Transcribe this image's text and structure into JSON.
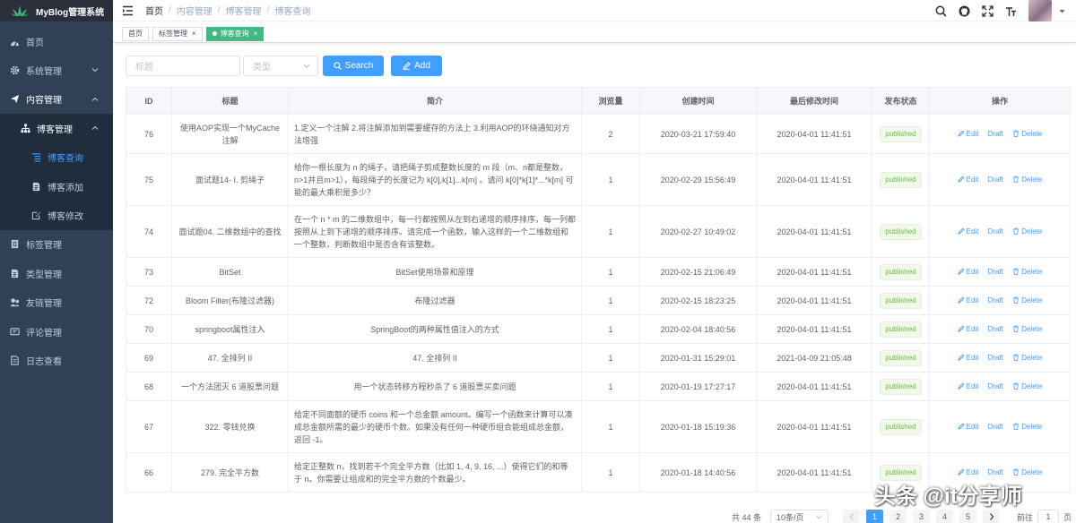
{
  "app": {
    "title": "MyBlog管理系统"
  },
  "sidebar": {
    "items": [
      {
        "label": "首页",
        "icon": "dashboard-icon"
      },
      {
        "label": "系统管理",
        "icon": "gear-icon"
      },
      {
        "label": "内容管理",
        "icon": "send-icon"
      },
      {
        "label": "博客管理",
        "icon": "tree-icon"
      },
      {
        "label": "博客查询",
        "icon": "list-icon"
      },
      {
        "label": "博客添加",
        "icon": "doc-icon"
      },
      {
        "label": "博客修改",
        "icon": "edit-icon"
      },
      {
        "label": "标签管理",
        "icon": "tag-icon"
      },
      {
        "label": "类型管理",
        "icon": "doc-icon"
      },
      {
        "label": "友链管理",
        "icon": "link-icon"
      },
      {
        "label": "评论管理",
        "icon": "chat-icon"
      },
      {
        "label": "日志查看",
        "icon": "log-icon"
      }
    ]
  },
  "breadcrumb": [
    "首页",
    "内容管理",
    "博客管理",
    "博客查询"
  ],
  "tags": [
    {
      "label": "首页"
    },
    {
      "label": "标签管理",
      "close": "×"
    },
    {
      "label": "博客查询",
      "close": "×"
    }
  ],
  "filter": {
    "title_placeholder": "标题",
    "type_placeholder": "类型",
    "search_label": "Search",
    "add_label": "Add"
  },
  "table": {
    "headers": [
      "ID",
      "标题",
      "简介",
      "浏览量",
      "创建时间",
      "最后修改时间",
      "发布状态",
      "操作"
    ],
    "actions": {
      "edit": "Edit",
      "draft": "Draft",
      "delete": "Delete"
    },
    "rows": [
      {
        "id": "76",
        "title": "使用AOP实现一个MyCache注解",
        "desc": "1.定义一个注解 2.将注解添加到需要缓存的方法上 3.利用AOP的环绕通知对方法增强",
        "views": "2",
        "created": "2020-03-21 17:59:40",
        "modified": "2020-04-01 11:41:51",
        "status": "published"
      },
      {
        "id": "75",
        "title": "面试题14- I. 剪绳子",
        "desc": "给你一根长度为 n 的绳子，请把绳子剪成整数长度的 m 段（m、n都是整数，n>1并且m>1），每段绳子的长度记为 k[0],k[1]...k[m] 。请问 k[0]*k[1]*...*k[m] 可能的最大乘积是多少？",
        "views": "1",
        "created": "2020-02-29 15:56:49",
        "modified": "2020-04-01 11:41:51",
        "status": "published"
      },
      {
        "id": "74",
        "title": "面试题04. 二维数组中的查找",
        "desc": "在一个 n * m 的二维数组中，每一行都按照从左到右递增的顺序排序，每一列都按照从上到下递增的顺序排序。请完成一个函数，输入这样的一个二维数组和一个整数，判断数组中是否含有该整数。",
        "views": "1",
        "created": "2020-02-27 10:49:02",
        "modified": "2020-04-01 11:41:51",
        "status": "published"
      },
      {
        "id": "73",
        "title": "BitSet",
        "desc": "BitSet使用场景和原理",
        "views": "1",
        "created": "2020-02-15 21:06:49",
        "modified": "2020-04-01 11:41:51",
        "status": "published"
      },
      {
        "id": "72",
        "title": "Bloom Filter(布隆过滤器)",
        "desc": "布隆过滤器",
        "views": "1",
        "created": "2020-02-15 18:23:25",
        "modified": "2020-04-01 11:41:51",
        "status": "published"
      },
      {
        "id": "70",
        "title": "springboot属性注入",
        "desc": "SpringBoot的两种属性值注入的方式",
        "views": "1",
        "created": "2020-02-04 18:40:56",
        "modified": "2020-04-01 11:41:51",
        "status": "published"
      },
      {
        "id": "69",
        "title": "47. 全排列 II",
        "desc": "47. 全排列 II",
        "views": "1",
        "created": "2020-01-31 15:29:01",
        "modified": "2021-04-09 21:05:48",
        "status": "published"
      },
      {
        "id": "68",
        "title": "一个方法团灭 6 道股票问题",
        "desc": "用一个状态转移方程秒杀了 6 道股票买卖问题",
        "views": "1",
        "created": "2020-01-19 17:27:17",
        "modified": "2020-04-01 11:41:51",
        "status": "published"
      },
      {
        "id": "67",
        "title": "322. 零钱兑换",
        "desc": "给定不同面额的硬币 coins 和一个总金额 amount。编写一个函数来计算可以凑成总金额所需的最少的硬币个数。如果没有任何一种硬币组合能组成总金额，返回 -1。",
        "views": "1",
        "created": "2020-01-18 15:19:36",
        "modified": "2020-04-01 11:41:51",
        "status": "published"
      },
      {
        "id": "66",
        "title": "279. 完全平方数",
        "desc": "给定正整数 n，找到若干个完全平方数（比如 1, 4, 9, 16, ...）使得它们的和等于 n。你需要让组成和的完全平方数的个数最少。",
        "views": "1",
        "created": "2020-01-18 14:40:56",
        "modified": "2020-04-01 11:41:51",
        "status": "published"
      }
    ]
  },
  "pagination": {
    "total": "共 44 条",
    "page_size": "10条/页",
    "pages": [
      "1",
      "2",
      "3",
      "4",
      "5"
    ],
    "current": "1",
    "goto_label": "前往",
    "goto_value": "1",
    "page_suffix": "页"
  },
  "watermark": "头条 @it分享师",
  "colors": {
    "sidebar": "#304156",
    "primary": "#409eff",
    "active_tag": "#42b983",
    "published": "#67c23a"
  }
}
